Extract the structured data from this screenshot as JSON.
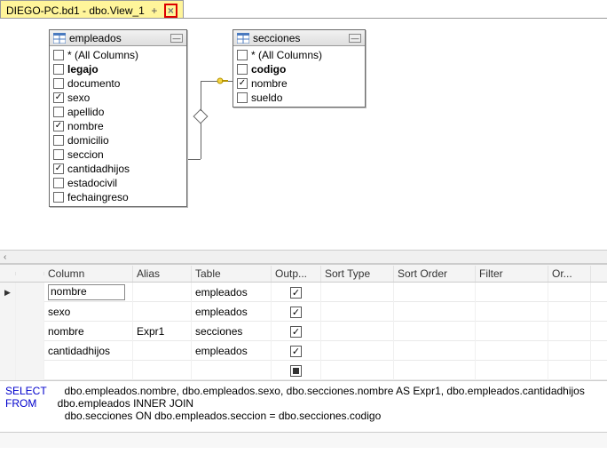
{
  "tab": {
    "title": "DIEGO-PC.bd1 - dbo.View_1",
    "plus": "+",
    "close": "×"
  },
  "tables": {
    "empleados": {
      "title": "empleados",
      "fields": [
        {
          "label": "* (All Columns)",
          "checked": false,
          "bold": false
        },
        {
          "label": "legajo",
          "checked": false,
          "bold": true
        },
        {
          "label": "documento",
          "checked": false,
          "bold": false
        },
        {
          "label": "sexo",
          "checked": true,
          "bold": false
        },
        {
          "label": "apellido",
          "checked": false,
          "bold": false
        },
        {
          "label": "nombre",
          "checked": true,
          "bold": false
        },
        {
          "label": "domicilio",
          "checked": false,
          "bold": false
        },
        {
          "label": "seccion",
          "checked": false,
          "bold": false
        },
        {
          "label": "cantidadhijos",
          "checked": true,
          "bold": false
        },
        {
          "label": "estadocivil",
          "checked": false,
          "bold": false
        },
        {
          "label": "fechaingreso",
          "checked": false,
          "bold": false
        }
      ]
    },
    "secciones": {
      "title": "secciones",
      "fields": [
        {
          "label": "* (All Columns)",
          "checked": false,
          "bold": false
        },
        {
          "label": "codigo",
          "checked": false,
          "bold": true
        },
        {
          "label": "nombre",
          "checked": true,
          "bold": false
        },
        {
          "label": "sueldo",
          "checked": false,
          "bold": false
        }
      ]
    }
  },
  "grid": {
    "headers": {
      "column": "Column",
      "alias": "Alias",
      "table": "Table",
      "output": "Outp...",
      "sorttype": "Sort Type",
      "sortorder": "Sort Order",
      "filter": "Filter",
      "or": "Or..."
    },
    "rows": [
      {
        "marker": "▶",
        "column": "nombre",
        "alias": "",
        "table": "empleados",
        "output": "checked"
      },
      {
        "marker": "",
        "column": "sexo",
        "alias": "",
        "table": "empleados",
        "output": "checked"
      },
      {
        "marker": "",
        "column": "nombre",
        "alias": "Expr1",
        "table": "secciones",
        "output": "checked"
      },
      {
        "marker": "",
        "column": "cantidadhijos",
        "alias": "",
        "table": "empleados",
        "output": "checked"
      },
      {
        "marker": "",
        "column": "",
        "alias": "",
        "table": "",
        "output": "filled"
      }
    ]
  },
  "sql": {
    "kw_select": "SELECT",
    "select_cols": "dbo.empleados.nombre, dbo.empleados.sexo, dbo.secciones.nombre AS Expr1, dbo.empleados.cantidadhijos",
    "kw_from": "FROM",
    "from_line": "dbo.empleados INNER JOIN",
    "on_line": "dbo.secciones ON dbo.empleados.seccion = dbo.secciones.codigo"
  }
}
